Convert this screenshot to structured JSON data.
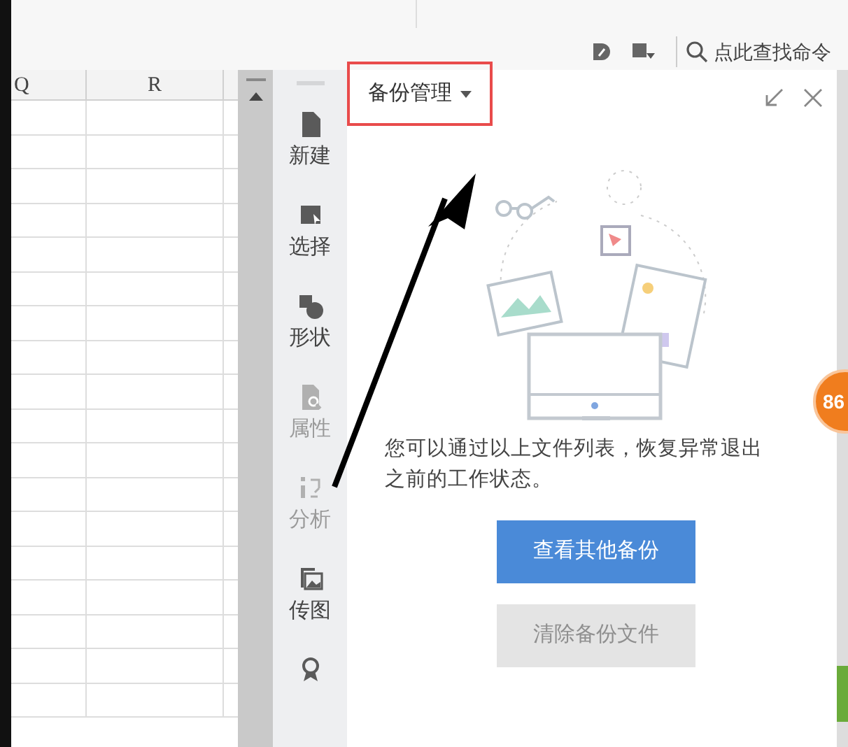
{
  "toolbar": {
    "search_label": "点此查找命令"
  },
  "sheet": {
    "columns": [
      "Q",
      "R"
    ]
  },
  "tools": [
    {
      "kind": "file",
      "label": "新建",
      "disabled": false
    },
    {
      "kind": "select",
      "label": "选择",
      "disabled": false
    },
    {
      "kind": "shape",
      "label": "形状",
      "disabled": false
    },
    {
      "kind": "props",
      "label": "属性",
      "disabled": true
    },
    {
      "kind": "analyze",
      "label": "分析",
      "disabled": true
    },
    {
      "kind": "image",
      "label": "传图",
      "disabled": false
    },
    {
      "kind": "award"
    }
  ],
  "panel": {
    "tab": {
      "label": "备份管理",
      "highlighted": true
    },
    "message": "您可以通过以上文件列表，恢复异常退出之前的工作状态。",
    "buttons": [
      {
        "label": "查看其他备份",
        "disabled": false
      },
      {
        "label": "清除备份文件",
        "disabled": true
      }
    ]
  },
  "badge": "86"
}
